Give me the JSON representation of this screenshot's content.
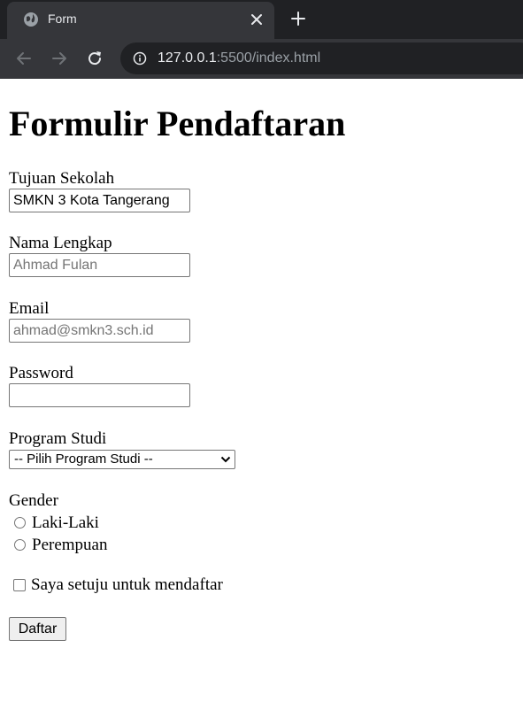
{
  "browser": {
    "tab_title": "Form",
    "url_host": "127.0.0.1",
    "url_rest": ":5500/index.html"
  },
  "form": {
    "title": "Formulir Pendaftaran",
    "school": {
      "label": "Tujuan Sekolah",
      "value": "SMKN 3 Kota Tangerang"
    },
    "name": {
      "label": "Nama Lengkap",
      "placeholder": "Ahmad Fulan"
    },
    "email": {
      "label": "Email",
      "placeholder": "ahmad@smkn3.sch.id"
    },
    "password": {
      "label": "Password"
    },
    "program": {
      "label": "Program Studi",
      "selected": "-- Pilih Program Studi --"
    },
    "gender": {
      "label": "Gender",
      "options": [
        {
          "label": "Laki-Laki"
        },
        {
          "label": "Perempuan"
        }
      ]
    },
    "agree_label": "Saya setuju untuk mendaftar",
    "submit_label": "Daftar"
  }
}
